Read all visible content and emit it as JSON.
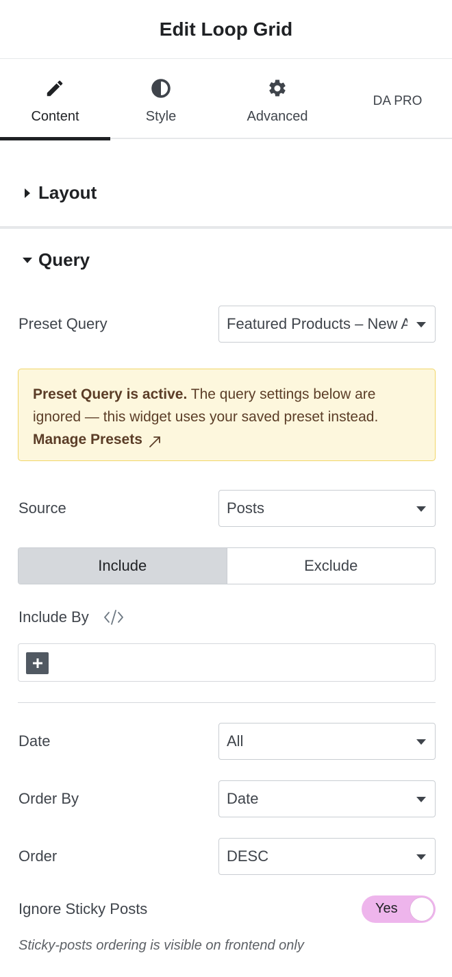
{
  "header": {
    "title": "Edit Loop Grid"
  },
  "tabs": [
    {
      "label": "Content",
      "icon": "pencil-icon",
      "active": true
    },
    {
      "label": "Style",
      "icon": "half-circle-icon",
      "active": false
    },
    {
      "label": "Advanced",
      "icon": "gear-icon",
      "active": false
    },
    {
      "label": "DA PRO",
      "icon": "",
      "active": false
    }
  ],
  "sections": {
    "layout": {
      "title": "Layout",
      "expanded": false
    },
    "query": {
      "title": "Query",
      "expanded": true
    }
  },
  "query": {
    "preset_query": {
      "label": "Preset Query",
      "value": "Featured Products – New Arrivals"
    },
    "notice": {
      "bold": "Preset Query is active.",
      "text": " The query settings below are ignored — this widget uses your saved preset instead.",
      "link": "Manage Presets",
      "link_icon": "external-arrow-icon"
    },
    "source": {
      "label": "Source",
      "value": "Posts"
    },
    "include_exclude": {
      "include": "Include",
      "exclude": "Exclude",
      "selected": "Include"
    },
    "include_by": {
      "label": "Include By",
      "icon": "code-icon"
    },
    "date": {
      "label": "Date",
      "value": "All"
    },
    "order_by": {
      "label": "Order By",
      "value": "Date"
    },
    "order": {
      "label": "Order",
      "value": "DESC"
    },
    "ignore_sticky": {
      "label": "Ignore Sticky Posts",
      "value": "Yes",
      "on": true
    },
    "sticky_hint": "Sticky-posts ordering is visible on frontend only"
  },
  "colors": {
    "toggle_on": "#eeb5ec",
    "notice_bg": "#fdf7dd",
    "notice_border": "#f1d667",
    "notice_text": "#5b3d27",
    "active_tab_bar": "#1f2124"
  }
}
